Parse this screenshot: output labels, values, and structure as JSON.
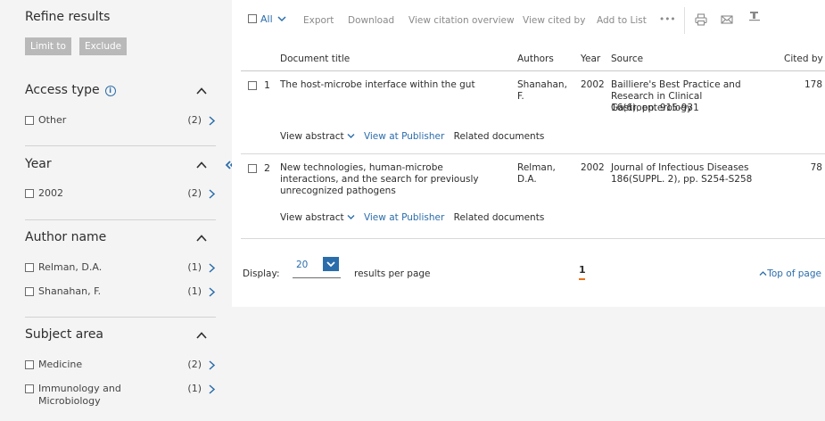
{
  "sidebar": {
    "title": "Refine results",
    "limit_label": "Limit to",
    "exclude_label": "Exclude",
    "facets": [
      {
        "title": "Access type",
        "items": [
          {
            "label": "Other",
            "count": "(2)"
          }
        ]
      },
      {
        "title": "Year",
        "items": [
          {
            "label": "2002",
            "count": "(2)"
          }
        ]
      },
      {
        "title": "Author name",
        "items": [
          {
            "label": "Relman, D.A.",
            "count": "(1)"
          },
          {
            "label": "Shanahan, F.",
            "count": "(1)"
          }
        ]
      },
      {
        "title": "Subject area",
        "items": [
          {
            "label": "Medicine",
            "count": "(2)"
          },
          {
            "label": "Immunology and Microbiology",
            "count": "(1)"
          }
        ]
      }
    ]
  },
  "toolbar": {
    "all_label": "All",
    "export": "Export",
    "download": "Download",
    "citation_overview": "View citation overview",
    "view_cited_by": "View cited by",
    "add_to_list": "Add to List",
    "more": "•••"
  },
  "table": {
    "headers": {
      "title": "Document title",
      "authors": "Authors",
      "year": "Year",
      "source": "Source",
      "cited_by": "Cited by"
    },
    "rows": [
      {
        "num": "1",
        "title": "The host-microbe interface within the gut",
        "authors": "Shanahan, F.",
        "year": "2002",
        "source": "Bailliere's Best Practice and Research in Clinical Gastroenterology",
        "source_detail": "16(6), pp. 915-931",
        "cited_by": "178",
        "view_abstract": "View abstract",
        "view_publisher": "View at Publisher",
        "related": "Related documents"
      },
      {
        "num": "2",
        "title": "New technologies, human-microbe interactions, and the search for previously unrecognized pathogens",
        "authors": "Relman, D.A.",
        "year": "2002",
        "source": "Journal of Infectious Diseases",
        "source_detail": "186(SUPPL. 2), pp. S254-S258",
        "cited_by": "78",
        "view_abstract": "View abstract",
        "view_publisher": "View at Publisher",
        "related": "Related documents"
      }
    ]
  },
  "footer": {
    "display_label": "Display:",
    "display_value": "20",
    "results_per_page": "results per page",
    "current_page": "1",
    "top_of_page": "Top of page"
  },
  "colors": {
    "link": "#2b6dab",
    "accent_underline": "#e9711c",
    "button_gray": "#b9b9b9"
  }
}
